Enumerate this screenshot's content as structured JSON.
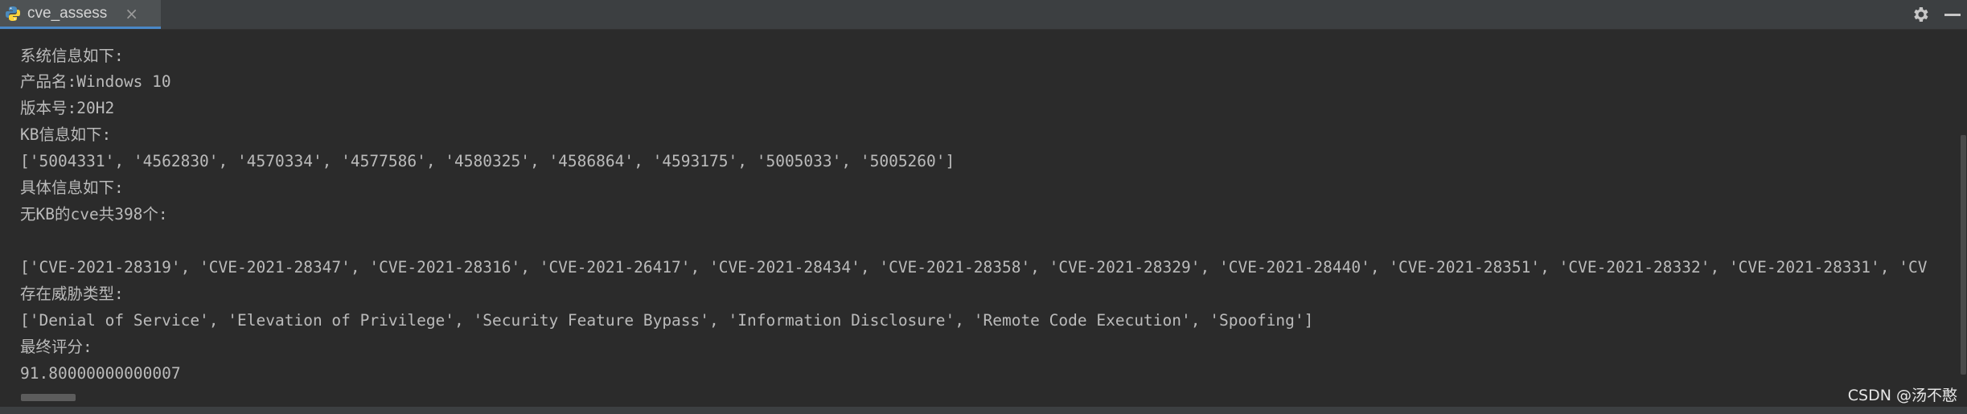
{
  "tab": {
    "title": "cve_assess",
    "close_label": "×",
    "icon": "python-icon"
  },
  "toolbar": {
    "settings_icon": "gear-icon",
    "minimize_icon": "minimize-icon"
  },
  "console": {
    "lines": [
      "系统信息如下:",
      "产品名:Windows 10",
      "版本号:20H2",
      "KB信息如下:",
      "['5004331', '4562830', '4570334', '4577586', '4580325', '4586864', '4593175', '5005033', '5005260']",
      "具体信息如下:",
      "无KB的cve共398个:",
      "",
      "['CVE-2021-28319', 'CVE-2021-28347', 'CVE-2021-28316', 'CVE-2021-26417', 'CVE-2021-28434', 'CVE-2021-28358', 'CVE-2021-28329', 'CVE-2021-28440', 'CVE-2021-28351', 'CVE-2021-28332', 'CVE-2021-28331', 'CV",
      "存在威胁类型:",
      "['Denial of Service', 'Elevation of Privilege', 'Security Feature Bypass', 'Information Disclosure', 'Remote Code Execution', 'Spoofing']",
      "最终评分:",
      "91.80000000000007"
    ]
  },
  "watermark": "CSDN @汤不憨",
  "colors": {
    "background": "#2b2b2b",
    "text": "#bbbbbb",
    "tabbar": "#3c3f41",
    "tab_active": "#4e5254",
    "accent": "#4a88c7"
  }
}
